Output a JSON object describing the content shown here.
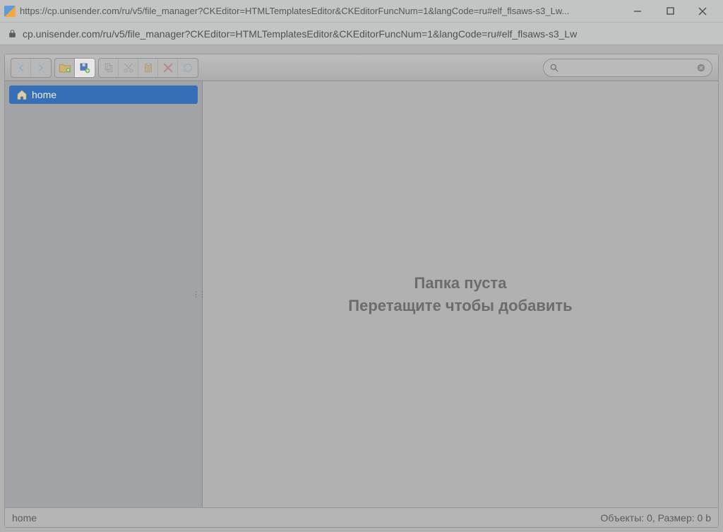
{
  "window": {
    "title": "https://cp.unisender.com/ru/v5/file_manager?CKEditor=HTMLTemplatesEditor&CKEditorFuncNum=1&langCode=ru#elf_flsaws-s3_Lw..."
  },
  "address": {
    "url": "cp.unisender.com/ru/v5/file_manager?CKEditor=HTMLTemplatesEditor&CKEditorFuncNum=1&langCode=ru#elf_flsaws-s3_Lw"
  },
  "toolbar": {
    "search_placeholder": ""
  },
  "sidebar": {
    "items": [
      {
        "label": "home"
      }
    ]
  },
  "main": {
    "empty_line1": "Папка пуста",
    "empty_line2": "Перетащите чтобы добавить"
  },
  "status": {
    "path": "home",
    "info": "Объекты: 0, Размер: 0 b"
  }
}
